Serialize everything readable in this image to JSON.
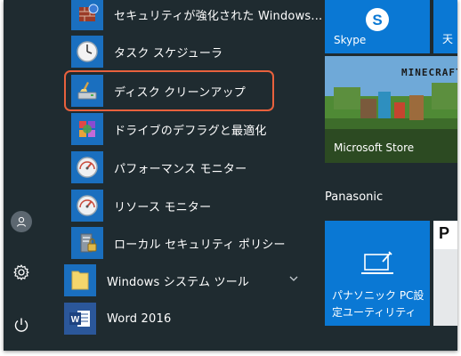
{
  "apps": [
    {
      "label": "セキュリティが強化された Windows...",
      "icon": "firewall-icon"
    },
    {
      "label": "タスク スケジューラ",
      "icon": "clock-icon"
    },
    {
      "label": "ディスク クリーンアップ",
      "icon": "disk-cleanup-icon"
    },
    {
      "label": "ドライブのデフラグと最適化",
      "icon": "defrag-icon"
    },
    {
      "label": "パフォーマンス モニター",
      "icon": "gauge-icon"
    },
    {
      "label": "リソース モニター",
      "icon": "gauge-icon"
    },
    {
      "label": "ローカル セキュリティ ポリシー",
      "icon": "security-policy-icon"
    }
  ],
  "groups": [
    {
      "label": "Windows システム ツール",
      "icon": "folder-icon",
      "expandable": true
    },
    {
      "label": "Word 2016",
      "icon": "word-icon",
      "expandable": false
    }
  ],
  "tiles": {
    "skype": {
      "label": "Skype",
      "color": "#0a78d4"
    },
    "store": {
      "label": "Microsoft Store",
      "art_text": "MINECRAFT"
    },
    "partial_top": {
      "label": "天",
      "color": "#0a78d4"
    },
    "panasonic_group": "Panasonic",
    "panasonic": {
      "label_line1": "パナソニック PC設",
      "label_line2": "定ユーティリティ",
      "color": "#0a78d4"
    },
    "partial_bottom": {
      "label": "P"
    }
  },
  "colors": {
    "background": "#1f2b30",
    "tile_blue": "#0a78d4",
    "highlight": "#e8613d"
  }
}
